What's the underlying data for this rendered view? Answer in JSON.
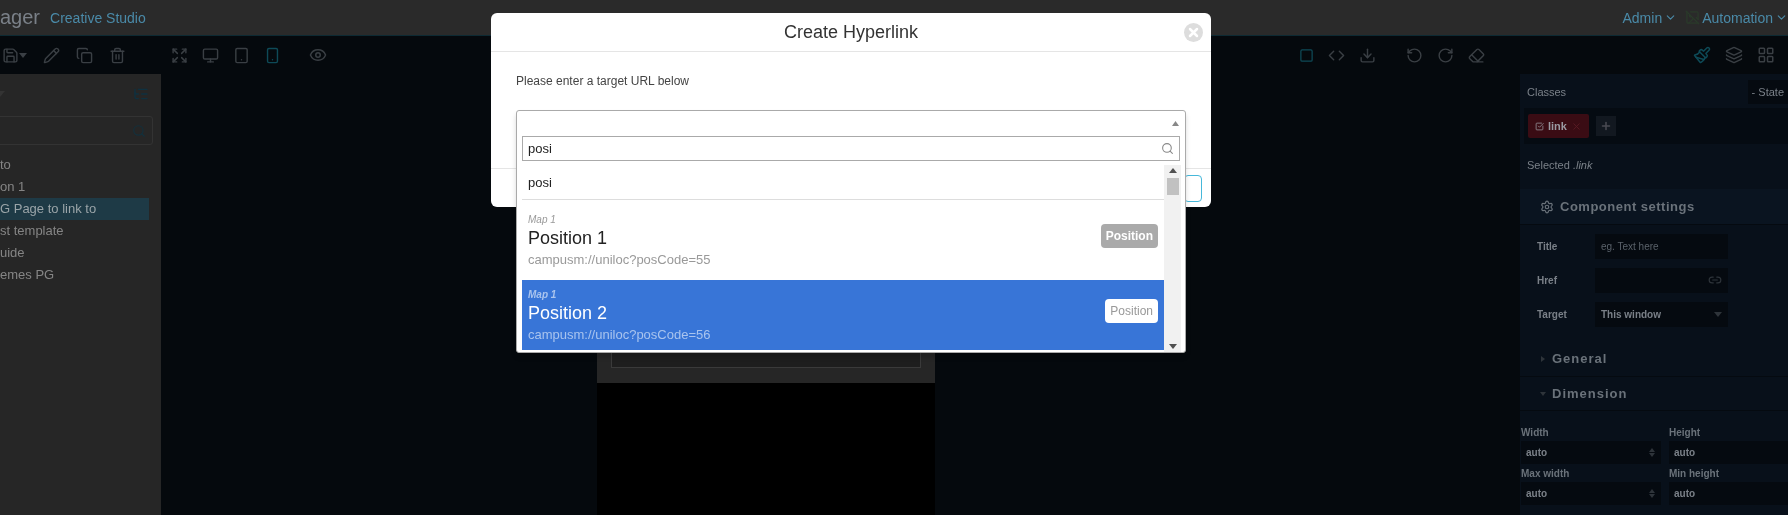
{
  "app_header": {
    "brand": "ager",
    "product": "Creative Studio",
    "user_menu": "Admin",
    "workspace_menu": "Automation"
  },
  "toolbar": {
    "outline_toggle": {
      "on": true
    },
    "devices": [
      {
        "kind": "desktop",
        "selected": false
      },
      {
        "kind": "tablet",
        "selected": false
      },
      {
        "kind": "mobile",
        "selected": true
      }
    ],
    "panels": [
      {
        "kind": "style",
        "selected": true
      },
      {
        "kind": "layers",
        "selected": false
      },
      {
        "kind": "blocks",
        "selected": false
      }
    ]
  },
  "page_list": {
    "items": [
      {
        "label": "to",
        "selected": false
      },
      {
        "label": "on 1",
        "selected": false
      },
      {
        "label": "G Page to link to",
        "selected": true
      },
      {
        "label": "st template",
        "selected": false
      },
      {
        "label": "uide",
        "selected": false
      },
      {
        "label": "emes PG",
        "selected": false
      }
    ]
  },
  "style_panel": {
    "classes_label": "Classes",
    "state_select": "- State",
    "tags": [
      {
        "label": "link",
        "checked": true
      }
    ],
    "selected_text": "Selected *.link*",
    "component_settings": {
      "title": "Component settings",
      "fields": [
        {
          "label": "Title",
          "kind": "text",
          "placeholder": "eg. Text here"
        },
        {
          "label": "Href",
          "kind": "link"
        },
        {
          "label": "Target",
          "kind": "select",
          "value": "This window"
        }
      ]
    },
    "sections": [
      {
        "title": "General",
        "expanded": false
      },
      {
        "title": "Dimension",
        "expanded": true
      }
    ],
    "dimension_fields": [
      {
        "label": "Width",
        "value": "auto"
      },
      {
        "label": "Height",
        "value": "auto"
      },
      {
        "label": "Max width",
        "value": "auto"
      },
      {
        "label": "Min height",
        "value": "auto"
      }
    ]
  },
  "dialog": {
    "title": "Create Hyperlink",
    "prompt": "Please enter a target URL below",
    "dropdown": {
      "expanded": true,
      "search_value": "posi",
      "results": [
        {
          "kind": "plain",
          "label": "posi",
          "selected": false
        },
        {
          "kind": "option",
          "group": "Map 1",
          "title": "Position 1",
          "url": "campusm://uniloc?posCode=55",
          "badge": "Position",
          "selected": false
        },
        {
          "kind": "option",
          "group": "Map 1",
          "title": "Position 2",
          "url": "campusm://uniloc?posCode=56",
          "badge": "Position",
          "selected": true
        }
      ]
    }
  }
}
